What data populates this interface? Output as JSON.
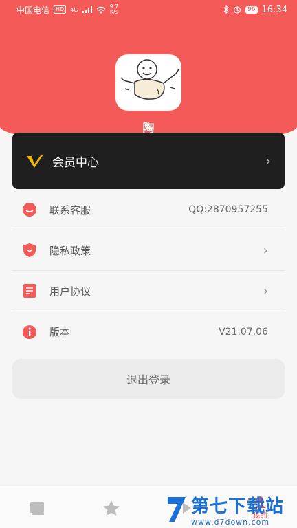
{
  "status_bar": {
    "carrier": "中国电信",
    "hd_badge": "HD",
    "network": "4G",
    "speed_value": "9.7",
    "speed_unit": "K/s",
    "battery": "96",
    "time": "16:34"
  },
  "profile": {
    "username": "陶"
  },
  "vip": {
    "label": "会员中心"
  },
  "menu": [
    {
      "label": "联系客服",
      "value": "QQ:2870957255",
      "icon": "chat-bubble-icon"
    },
    {
      "label": "隐私政策",
      "value": "",
      "icon": "shield-icon"
    },
    {
      "label": "用户协议",
      "value": "",
      "icon": "document-icon"
    },
    {
      "label": "版本",
      "value": "V21.07.06",
      "icon": "info-icon"
    }
  ],
  "logout_label": "退出登录",
  "tabbar": {
    "active_label": "我的"
  },
  "watermark": {
    "title": "第七下载站",
    "url": "www.d7down.com"
  },
  "colors": {
    "brand_red": "#f35a58",
    "vip_gold": "#f5b800",
    "dark_card": "#1f1f1f"
  }
}
